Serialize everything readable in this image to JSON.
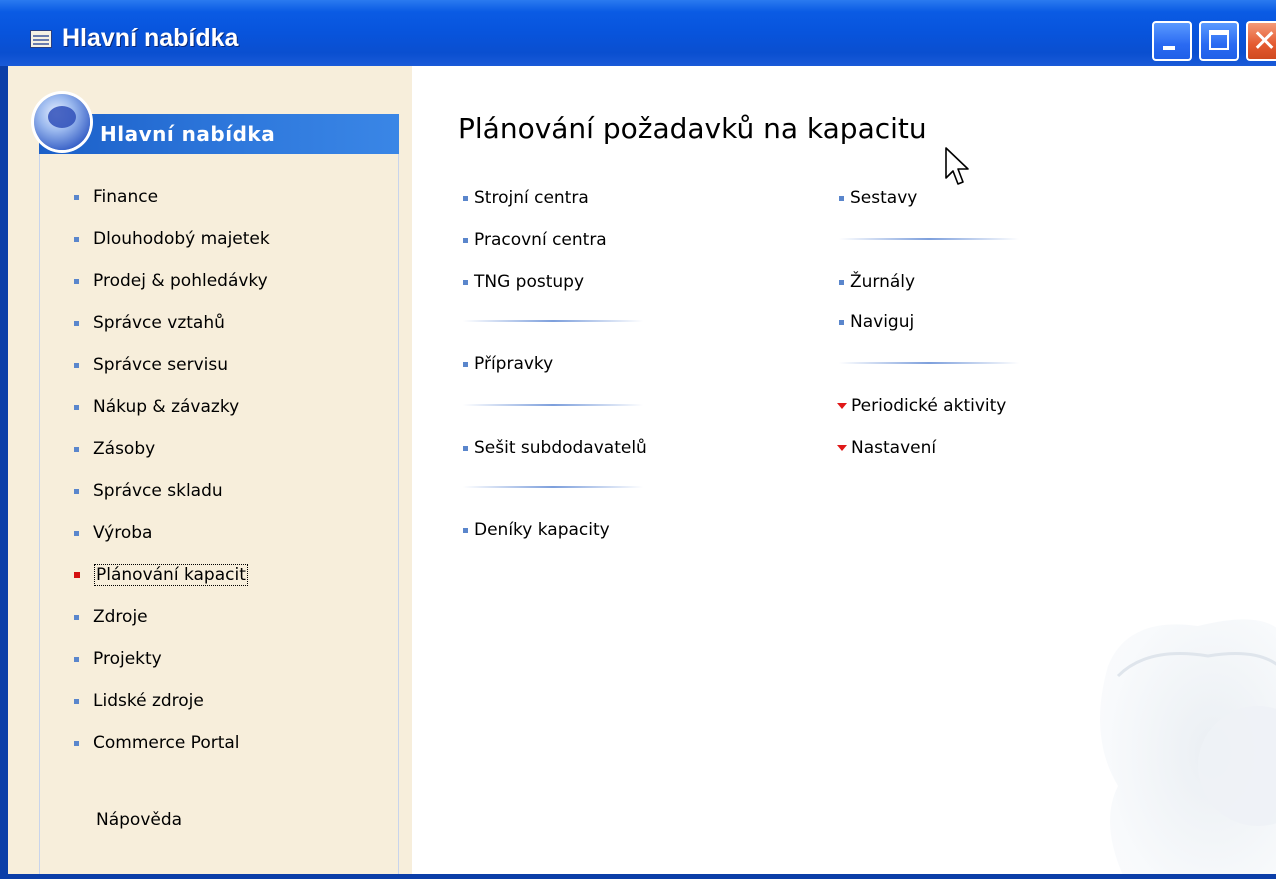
{
  "window": {
    "title": "Hlavní nabídka"
  },
  "sidebar": {
    "header": "Hlavní nabídka",
    "items": [
      {
        "label": "Finance"
      },
      {
        "label": "Dlouhodobý majetek"
      },
      {
        "label": "Prodej & pohledávky"
      },
      {
        "label": "Správce vztahů"
      },
      {
        "label": "Správce servisu"
      },
      {
        "label": "Nákup & závazky"
      },
      {
        "label": "Zásoby"
      },
      {
        "label": "Správce skladu"
      },
      {
        "label": "Výroba"
      },
      {
        "label": "Plánování kapacit",
        "selected": true
      },
      {
        "label": "Zdroje"
      },
      {
        "label": "Projekty"
      },
      {
        "label": "Lidské zdroje"
      },
      {
        "label": "Commerce Portal"
      }
    ],
    "help": "Nápověda"
  },
  "main": {
    "title": "Plánování požadavků na kapacitu",
    "left_links": [
      "Strojní centra",
      "Pracovní centra",
      "TNG postupy",
      "Přípravky",
      "Sešit subdodavatelů",
      "Deníky kapacity"
    ],
    "right_links": [
      "Sestavy",
      "Žurnály",
      "Naviguj"
    ],
    "right_menus": [
      "Periodické aktivity",
      "Nastavení"
    ]
  },
  "colors": {
    "titlebar": "#0854dc",
    "sidebar_bg": "#f7eedb",
    "header_blue": "#2e78dc",
    "bullet_blue": "#5a86cc",
    "accent_red": "#e01818"
  }
}
